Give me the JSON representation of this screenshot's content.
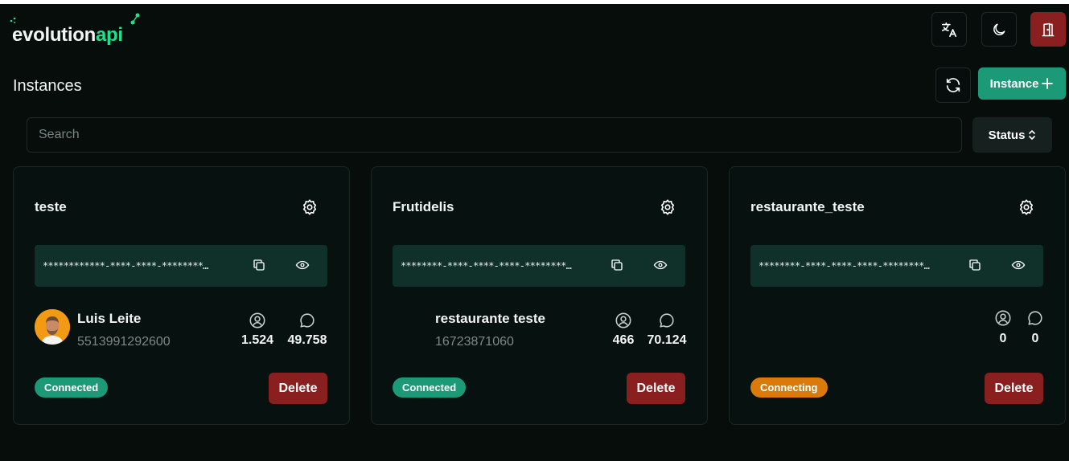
{
  "app": {
    "logo_part1": "evolution",
    "logo_part2": "api"
  },
  "header": {
    "language_icon": "translate-icon",
    "theme_icon": "moon-icon",
    "logout_icon": "door-exit-icon"
  },
  "page": {
    "title": "Instances",
    "add_button_label": "Instance",
    "search_placeholder": "Search",
    "status_filter_label": "Status"
  },
  "colors": {
    "accent": "#1c9a78",
    "danger": "#8a1f1f",
    "warning": "#d97a0b",
    "brand_green": "#1ee08e"
  },
  "instances": [
    {
      "name": "teste",
      "token_masked": "************-****-****-********…",
      "profile_name": "Luis Leite",
      "number": "5513991292600",
      "contacts": "1.524",
      "chats": "49.758",
      "status": "Connected",
      "delete_label": "Delete"
    },
    {
      "name": "Frutidelis",
      "token_masked": "********-****-****-****-********…",
      "profile_name": "restaurante teste",
      "number": "16723871060",
      "contacts": "466",
      "chats": "70.124",
      "status": "Connected",
      "delete_label": "Delete"
    },
    {
      "name": "restaurante_teste",
      "token_masked": "********-****-****-****-********…",
      "profile_name": "",
      "number": "",
      "contacts": "0",
      "chats": "0",
      "status": "Connecting",
      "delete_label": "Delete"
    }
  ]
}
